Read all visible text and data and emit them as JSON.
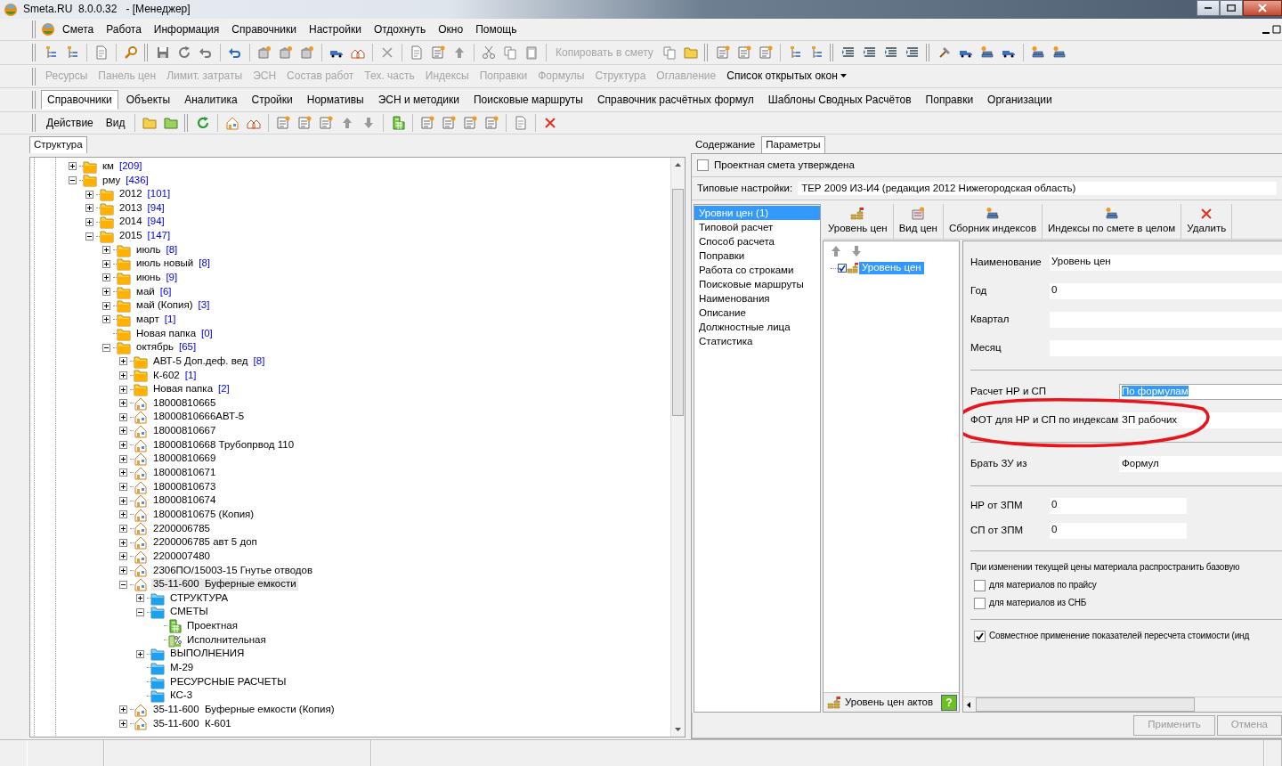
{
  "window": {
    "title": "Smeta.RU  8.0.0.32   - [Менеджер]"
  },
  "menu": [
    "Смета",
    "Работа",
    "Информация",
    "Справочники",
    "Настройки",
    "Отдохнуть",
    "Окно",
    "Помощь"
  ],
  "toolbar": {
    "copy_button": {
      "label": "Копировать в смету",
      "disabled": true
    }
  },
  "panel_buttons": [
    {
      "label": "Ресурсы",
      "disabled": true,
      "kind": "plain"
    },
    {
      "label": "Панель цен",
      "disabled": true,
      "kind": "plain"
    },
    {
      "label": "Лимит. затраты",
      "disabled": true,
      "kind": "plain"
    },
    {
      "label": "ЭСН",
      "disabled": true,
      "kind": "plain"
    },
    {
      "label": "Состав работ",
      "disabled": true,
      "kind": "plain"
    },
    {
      "label": "Тех. часть",
      "disabled": true,
      "kind": "plain"
    },
    {
      "label": "Индексы",
      "disabled": true,
      "kind": "plain"
    },
    {
      "label": "Поправки",
      "disabled": true,
      "kind": "plain"
    },
    {
      "label": "Формулы",
      "disabled": true,
      "kind": "plain"
    },
    {
      "label": "Структура",
      "disabled": true,
      "kind": "plain"
    },
    {
      "label": "Оглавление",
      "disabled": true,
      "kind": "plain"
    },
    {
      "label": "Список открытых окон",
      "disabled": false,
      "kind": "dropdown"
    }
  ],
  "module_tabs": [
    {
      "label": "Справочники",
      "selected": true
    },
    {
      "label": "Объекты",
      "selected": false
    },
    {
      "label": "Аналитика",
      "selected": false
    },
    {
      "label": "Стройки",
      "selected": false
    },
    {
      "label": "Нормативы",
      "selected": false
    },
    {
      "label": "ЭСН и методики",
      "selected": false
    },
    {
      "label": "Поисковые маршруты",
      "selected": false
    },
    {
      "label": "Справочник расчётных формул",
      "selected": false
    },
    {
      "label": "Шаблоны Сводных Расчётов",
      "selected": false
    },
    {
      "label": "Поправки",
      "selected": false
    },
    {
      "label": "Организации",
      "selected": false
    }
  ],
  "action_menu": [
    "Действие",
    "Вид"
  ],
  "left_panel": {
    "tab": "Структура",
    "tree": [
      {
        "label": "км",
        "count": "[209]",
        "kind": "folder",
        "expanded": false,
        "selected": false
      },
      {
        "label": "рму",
        "count": "[436]",
        "kind": "folder",
        "expanded": true,
        "selected": false,
        "children": [
          {
            "label": "2012",
            "count": "[101]",
            "kind": "folder",
            "expanded": false,
            "selected": false
          },
          {
            "label": "2013",
            "count": "[94]",
            "kind": "folder",
            "expanded": false,
            "selected": false
          },
          {
            "label": "2014",
            "count": "[94]",
            "kind": "folder",
            "expanded": false,
            "selected": false
          },
          {
            "label": "2015",
            "count": "[147]",
            "kind": "folder",
            "expanded": true,
            "selected": false,
            "children": [
              {
                "label": "июль",
                "count": "[8]",
                "kind": "folder",
                "expanded": false,
                "selected": false
              },
              {
                "label": "июль новый",
                "count": "[8]",
                "kind": "folder",
                "expanded": false,
                "selected": false
              },
              {
                "label": "июнь",
                "count": "[9]",
                "kind": "folder",
                "expanded": false,
                "selected": false
              },
              {
                "label": "май",
                "count": "[6]",
                "kind": "folder",
                "expanded": false,
                "selected": false
              },
              {
                "label": "май (Копия)",
                "count": "[3]",
                "kind": "folder",
                "expanded": false,
                "selected": false
              },
              {
                "label": "март",
                "count": "[1]",
                "kind": "folder",
                "expanded": false,
                "selected": false
              },
              {
                "label": "Новая папка",
                "count": "[0]",
                "kind": "folder",
                "selected": false
              },
              {
                "label": "октябрь",
                "count": "[65]",
                "kind": "folder",
                "expanded": true,
                "selected": false,
                "children": [
                  {
                    "label": "АВТ-5 Доп.деф. вед",
                    "count": "[8]",
                    "kind": "folder",
                    "expanded": false,
                    "selected": false
                  },
                  {
                    "label": "К-602",
                    "count": "[1]",
                    "kind": "folder",
                    "expanded": false,
                    "selected": false
                  },
                  {
                    "label": "Новая папка",
                    "count": "[2]",
                    "kind": "folder",
                    "expanded": false,
                    "selected": false
                  },
                  {
                    "label": "18000810665",
                    "kind": "house",
                    "expanded": false,
                    "selected": false
                  },
                  {
                    "label": "18000810666АВТ-5",
                    "kind": "house",
                    "expanded": false,
                    "selected": false
                  },
                  {
                    "label": "18000810667",
                    "kind": "house",
                    "expanded": false,
                    "selected": false
                  },
                  {
                    "label": "18000810668 Трубопрвод 110",
                    "kind": "house",
                    "expanded": false,
                    "selected": false
                  },
                  {
                    "label": "18000810669",
                    "kind": "house",
                    "expanded": false,
                    "selected": false
                  },
                  {
                    "label": "18000810671",
                    "kind": "house",
                    "expanded": false,
                    "selected": false
                  },
                  {
                    "label": "18000810673",
                    "kind": "house",
                    "expanded": false,
                    "selected": false
                  },
                  {
                    "label": "18000810674",
                    "kind": "house",
                    "expanded": false,
                    "selected": false
                  },
                  {
                    "label": "18000810675 (Копия)",
                    "kind": "house",
                    "expanded": false,
                    "selected": false
                  },
                  {
                    "label": "2200006785",
                    "kind": "house",
                    "expanded": false,
                    "selected": false
                  },
                  {
                    "label": "2200006785 авт 5 доп",
                    "kind": "house",
                    "expanded": false,
                    "selected": false
                  },
                  {
                    "label": "2200007480",
                    "kind": "house",
                    "expanded": false,
                    "selected": false
                  },
                  {
                    "label": "2306ПО/15003-15 Гнутье отводов",
                    "kind": "house",
                    "expanded": false,
                    "selected": false
                  },
                  {
                    "label": "35-11-600  Буферные емкости",
                    "kind": "house",
                    "expanded": true,
                    "selected": true,
                    "children": [
                      {
                        "label": "СТРУКТУРА",
                        "kind": "blue_folder",
                        "expanded": false,
                        "selected": false
                      },
                      {
                        "label": "СМЕТЫ",
                        "kind": "blue_folder",
                        "expanded": true,
                        "selected": false,
                        "children": [
                          {
                            "label": "Проектная",
                            "kind": "estimate",
                            "selected": false
                          },
                          {
                            "label": "Исполнительная",
                            "kind": "estimate_percent",
                            "selected": false
                          }
                        ]
                      },
                      {
                        "label": "ВЫПОЛНЕНИЯ",
                        "kind": "blue_folder",
                        "expanded": false,
                        "selected": false
                      },
                      {
                        "label": "М-29",
                        "kind": "blue_folder",
                        "selected": false
                      },
                      {
                        "label": "РЕСУРСНЫЕ РАСЧЕТЫ",
                        "kind": "blue_folder",
                        "selected": false
                      },
                      {
                        "label": "КС-3",
                        "kind": "blue_folder",
                        "selected": false
                      }
                    ]
                  },
                  {
                    "label": "35-11-600  Буферные емкости (Копия)",
                    "kind": "house",
                    "expanded": false,
                    "selected": false
                  },
                  {
                    "label": "35-11-600  К-601",
                    "kind": "house",
                    "expanded": false,
                    "selected": false
                  }
                ]
              }
            ]
          }
        ]
      }
    ]
  },
  "right_panel": {
    "tabs": [
      {
        "label": "Содержание",
        "selected": false
      },
      {
        "label": "Параметры",
        "selected": true
      }
    ],
    "approved": {
      "label": "Проектная смета утверждена",
      "checked": false
    },
    "preset": {
      "label": "Типовые настройки:",
      "value": "ТЕР 2009 И3-И4 (редакция 2012 Нижегородская область)"
    },
    "sections": [
      {
        "label": "Уровни цен (1)",
        "selected": true
      },
      {
        "label": "Типовой расчет",
        "selected": false
      },
      {
        "label": "Способ расчета",
        "selected": false
      },
      {
        "label": "Поправки",
        "selected": false
      },
      {
        "label": "Работа со строками",
        "selected": false
      },
      {
        "label": "Поисковые маршруты",
        "selected": false
      },
      {
        "label": "Наименования",
        "selected": false
      },
      {
        "label": "Описание",
        "selected": false
      },
      {
        "label": "Должностные лица",
        "selected": false
      },
      {
        "label": "Статистика",
        "selected": false
      }
    ],
    "tools": [
      {
        "label": "Уровень цен",
        "kind": "coins"
      },
      {
        "label": "Вид цен",
        "kind": "price"
      },
      {
        "label": "Сборник индексов",
        "kind": "books"
      },
      {
        "label": "Индексы по смете в целом",
        "kind": "books"
      },
      {
        "label": "Удалить",
        "kind": "delete"
      }
    ],
    "levels": [
      {
        "label": "Уровень цен",
        "checked": true,
        "selected": true
      }
    ],
    "acts": {
      "label": "Уровень цен актов",
      "help": "?"
    },
    "form": [
      {
        "kind": "text",
        "label": "Наименование",
        "value": "Уровень цен"
      },
      {
        "kind": "text",
        "label": "Год",
        "value": "0"
      },
      {
        "kind": "text",
        "label": "Квартал"
      },
      {
        "kind": "text",
        "label": "Месяц"
      },
      {
        "kind": "divider"
      },
      {
        "kind": "select",
        "label": "Расчет НР и СП",
        "value": "По формулам",
        "focused": true,
        "circled": false
      },
      {
        "kind": "select",
        "label": "ФОТ для НР и СП по индексам",
        "value": "ЗП рабочих",
        "focused": false,
        "circled": true
      },
      {
        "kind": "divider"
      },
      {
        "kind": "select",
        "label": "Брать ЗУ из",
        "value": "Формул",
        "focused": false,
        "circled": false
      },
      {
        "kind": "divider"
      },
      {
        "kind": "short",
        "label": "НР от ЗПМ",
        "value": "0"
      },
      {
        "kind": "short",
        "label": "СП от ЗПМ",
        "value": "0"
      },
      {
        "kind": "divider"
      },
      {
        "kind": "note",
        "label": "При изменении текущей цены материала распространить базовую"
      },
      {
        "kind": "check",
        "label": "для материалов по прайсу",
        "checked": false
      },
      {
        "kind": "check",
        "label": "для материалов из СНБ",
        "checked": false
      },
      {
        "kind": "divider"
      },
      {
        "kind": "check",
        "label": "Совместное применение показателей пересчета стоимости (инд",
        "checked": true
      }
    ],
    "buttons": [
      {
        "label": "Применить",
        "disabled": true
      },
      {
        "label": "Отмена",
        "disabled": true
      }
    ]
  }
}
